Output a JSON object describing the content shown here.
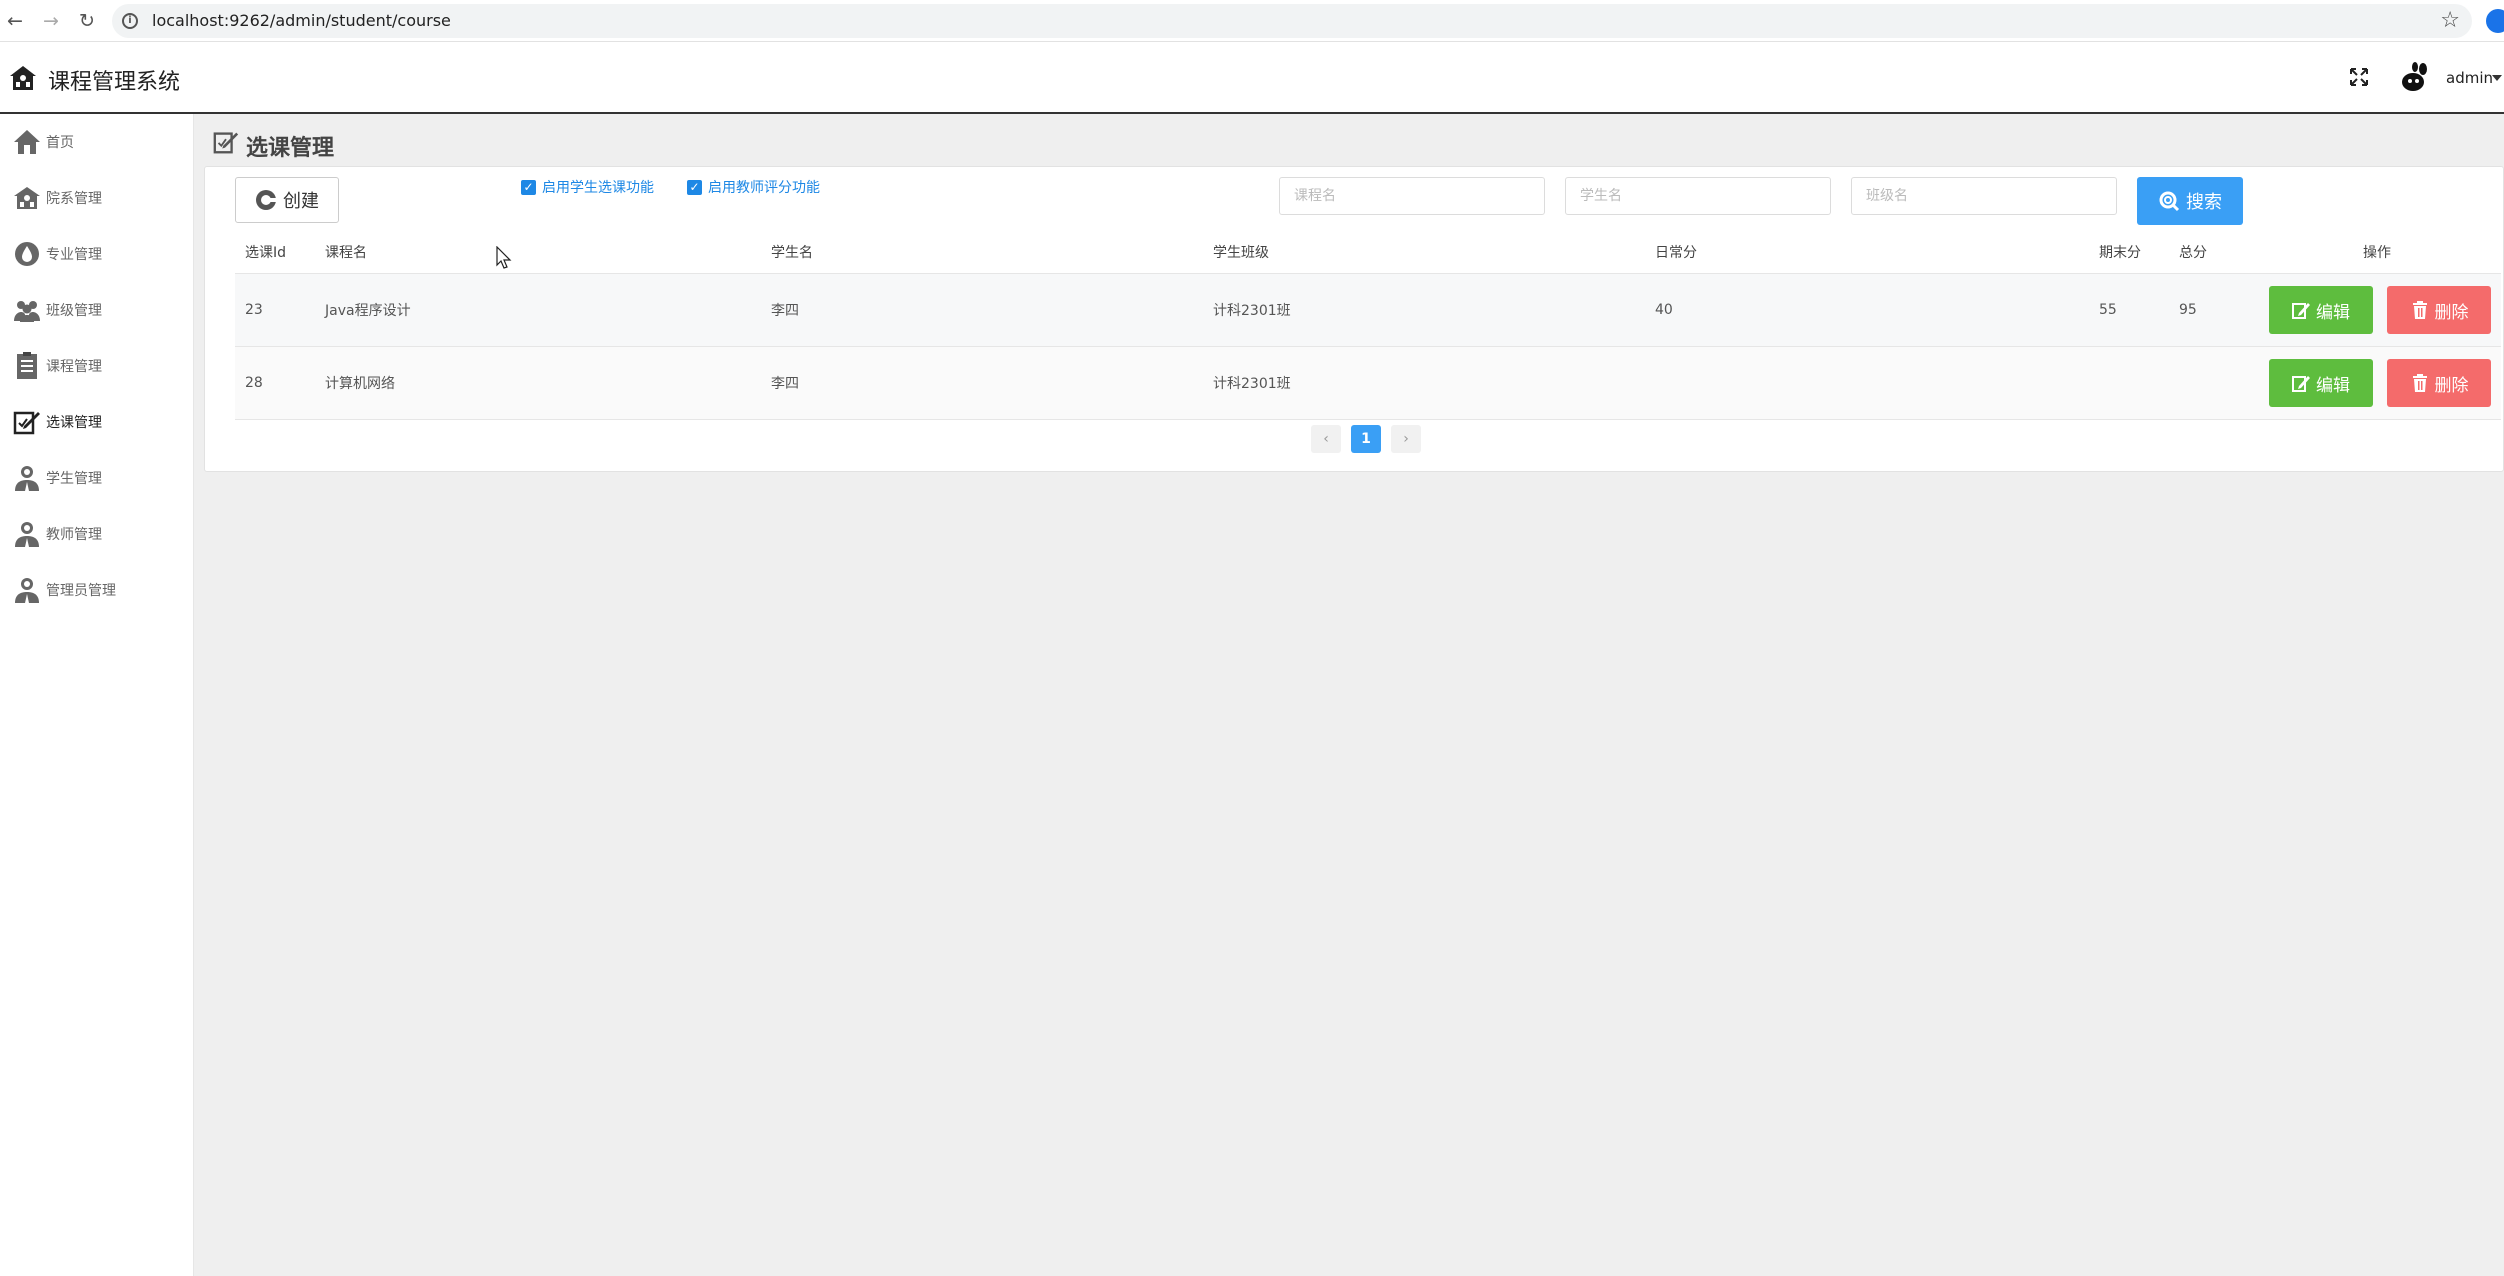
{
  "browser": {
    "url": "localhost:9262/admin/student/course",
    "back": "←",
    "forward": "→",
    "reload": "↻",
    "star": "☆"
  },
  "app": {
    "title": "课程管理系统",
    "user": "admin"
  },
  "sidebar": {
    "items": [
      {
        "label": "首页",
        "icon": "home-icon"
      },
      {
        "label": "院系管理",
        "icon": "building-icon"
      },
      {
        "label": "专业管理",
        "icon": "drop-icon"
      },
      {
        "label": "班级管理",
        "icon": "group-icon"
      },
      {
        "label": "课程管理",
        "icon": "document-icon"
      },
      {
        "label": "选课管理",
        "icon": "edit-icon",
        "active": true
      },
      {
        "label": "学生管理",
        "icon": "person-icon"
      },
      {
        "label": "教师管理",
        "icon": "person-icon"
      },
      {
        "label": "管理员管理",
        "icon": "person-icon"
      }
    ]
  },
  "page": {
    "title": "选课管理"
  },
  "toolbar": {
    "create_label": "创建",
    "check1_label": "启用学生选课功能",
    "check2_label": "启用教师评分功能",
    "course_placeholder": "课程名",
    "student_placeholder": "学生名",
    "class_placeholder": "班级名",
    "search_label": "搜索"
  },
  "table": {
    "headers": [
      "选课Id",
      "课程名",
      "学生名",
      "学生班级",
      "日常分",
      "期末分",
      "总分",
      "操作"
    ],
    "rows": [
      {
        "id": "23",
        "course": "Java程序设计",
        "student": "李四",
        "class": "计科2301班",
        "daily": "40",
        "final": "55",
        "total": "95"
      },
      {
        "id": "28",
        "course": "计算机网络",
        "student": "李四",
        "class": "计科2301班",
        "daily": "",
        "final": "",
        "total": ""
      }
    ],
    "edit_label": "编辑",
    "delete_label": "删除"
  },
  "pagination": {
    "prev": "‹",
    "current": "1",
    "next": "›"
  },
  "colors": {
    "primary": "#3a9ff5",
    "edit": "#5ebd3e",
    "delete": "#f46b6b"
  }
}
